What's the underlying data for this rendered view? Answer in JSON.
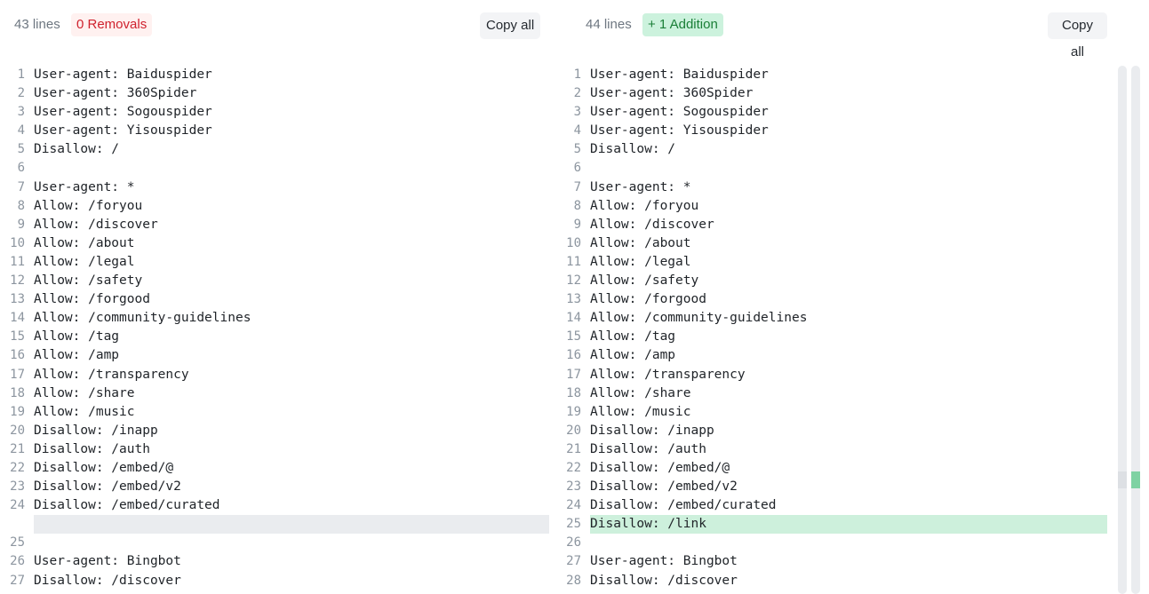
{
  "left": {
    "line_count": "43 lines",
    "badge": "0 Removals",
    "copy_label": "Copy all",
    "lines": [
      {
        "n": "1",
        "text": "User-agent: Baiduspider"
      },
      {
        "n": "2",
        "text": "User-agent: 360Spider"
      },
      {
        "n": "3",
        "text": "User-agent: Sogouspider"
      },
      {
        "n": "4",
        "text": "User-agent: Yisouspider"
      },
      {
        "n": "5",
        "text": "Disallow: /"
      },
      {
        "n": "6",
        "text": ""
      },
      {
        "n": "7",
        "text": "User-agent: *"
      },
      {
        "n": "8",
        "text": "Allow: /foryou"
      },
      {
        "n": "9",
        "text": "Allow: /discover"
      },
      {
        "n": "10",
        "text": "Allow: /about"
      },
      {
        "n": "11",
        "text": "Allow: /legal"
      },
      {
        "n": "12",
        "text": "Allow: /safety"
      },
      {
        "n": "13",
        "text": "Allow: /forgood"
      },
      {
        "n": "14",
        "text": "Allow: /community-guidelines"
      },
      {
        "n": "15",
        "text": "Allow: /tag"
      },
      {
        "n": "16",
        "text": "Allow: /amp"
      },
      {
        "n": "17",
        "text": "Allow: /transparency"
      },
      {
        "n": "18",
        "text": "Allow: /share"
      },
      {
        "n": "19",
        "text": "Allow: /music"
      },
      {
        "n": "20",
        "text": "Disallow: /inapp"
      },
      {
        "n": "21",
        "text": "Disallow: /auth"
      },
      {
        "n": "22",
        "text": "Disallow: /embed/@"
      },
      {
        "n": "23",
        "text": "Disallow: /embed/v2"
      },
      {
        "n": "24",
        "text": "Disallow: /embed/curated"
      },
      {
        "n": "",
        "text": ""
      },
      {
        "n": "25",
        "text": ""
      },
      {
        "n": "26",
        "text": "User-agent: Bingbot"
      },
      {
        "n": "27",
        "text": "Disallow: /discover"
      }
    ]
  },
  "right": {
    "line_count": "44 lines",
    "badge": "+ 1 Addition",
    "copy_label": "Copy all",
    "lines": [
      {
        "n": "1",
        "text": "User-agent: Baiduspider"
      },
      {
        "n": "2",
        "text": "User-agent: 360Spider"
      },
      {
        "n": "3",
        "text": "User-agent: Sogouspider"
      },
      {
        "n": "4",
        "text": "User-agent: Yisouspider"
      },
      {
        "n": "5",
        "text": "Disallow: /"
      },
      {
        "n": "6",
        "text": ""
      },
      {
        "n": "7",
        "text": "User-agent: *"
      },
      {
        "n": "8",
        "text": "Allow: /foryou"
      },
      {
        "n": "9",
        "text": "Allow: /discover"
      },
      {
        "n": "10",
        "text": "Allow: /about"
      },
      {
        "n": "11",
        "text": "Allow: /legal"
      },
      {
        "n": "12",
        "text": "Allow: /safety"
      },
      {
        "n": "13",
        "text": "Allow: /forgood"
      },
      {
        "n": "14",
        "text": "Allow: /community-guidelines"
      },
      {
        "n": "15",
        "text": "Allow: /tag"
      },
      {
        "n": "16",
        "text": "Allow: /amp"
      },
      {
        "n": "17",
        "text": "Allow: /transparency"
      },
      {
        "n": "18",
        "text": "Allow: /share"
      },
      {
        "n": "19",
        "text": "Allow: /music"
      },
      {
        "n": "20",
        "text": "Disallow: /inapp"
      },
      {
        "n": "21",
        "text": "Disallow: /auth"
      },
      {
        "n": "22",
        "text": "Disallow: /embed/@"
      },
      {
        "n": "23",
        "text": "Disallow: /embed/v2"
      },
      {
        "n": "24",
        "text": "Disallow: /embed/curated"
      },
      {
        "n": "25",
        "text": "Disallow: /link"
      },
      {
        "n": "26",
        "text": ""
      },
      {
        "n": "27",
        "text": "User-agent: Bingbot"
      },
      {
        "n": "28",
        "text": "Disallow: /discover"
      }
    ]
  },
  "colors": {
    "removal_text": "#cf222e",
    "addition_text": "#1a7f37",
    "addition_bg": "#cdf0dc",
    "placeholder_bg": "#eaecef"
  }
}
